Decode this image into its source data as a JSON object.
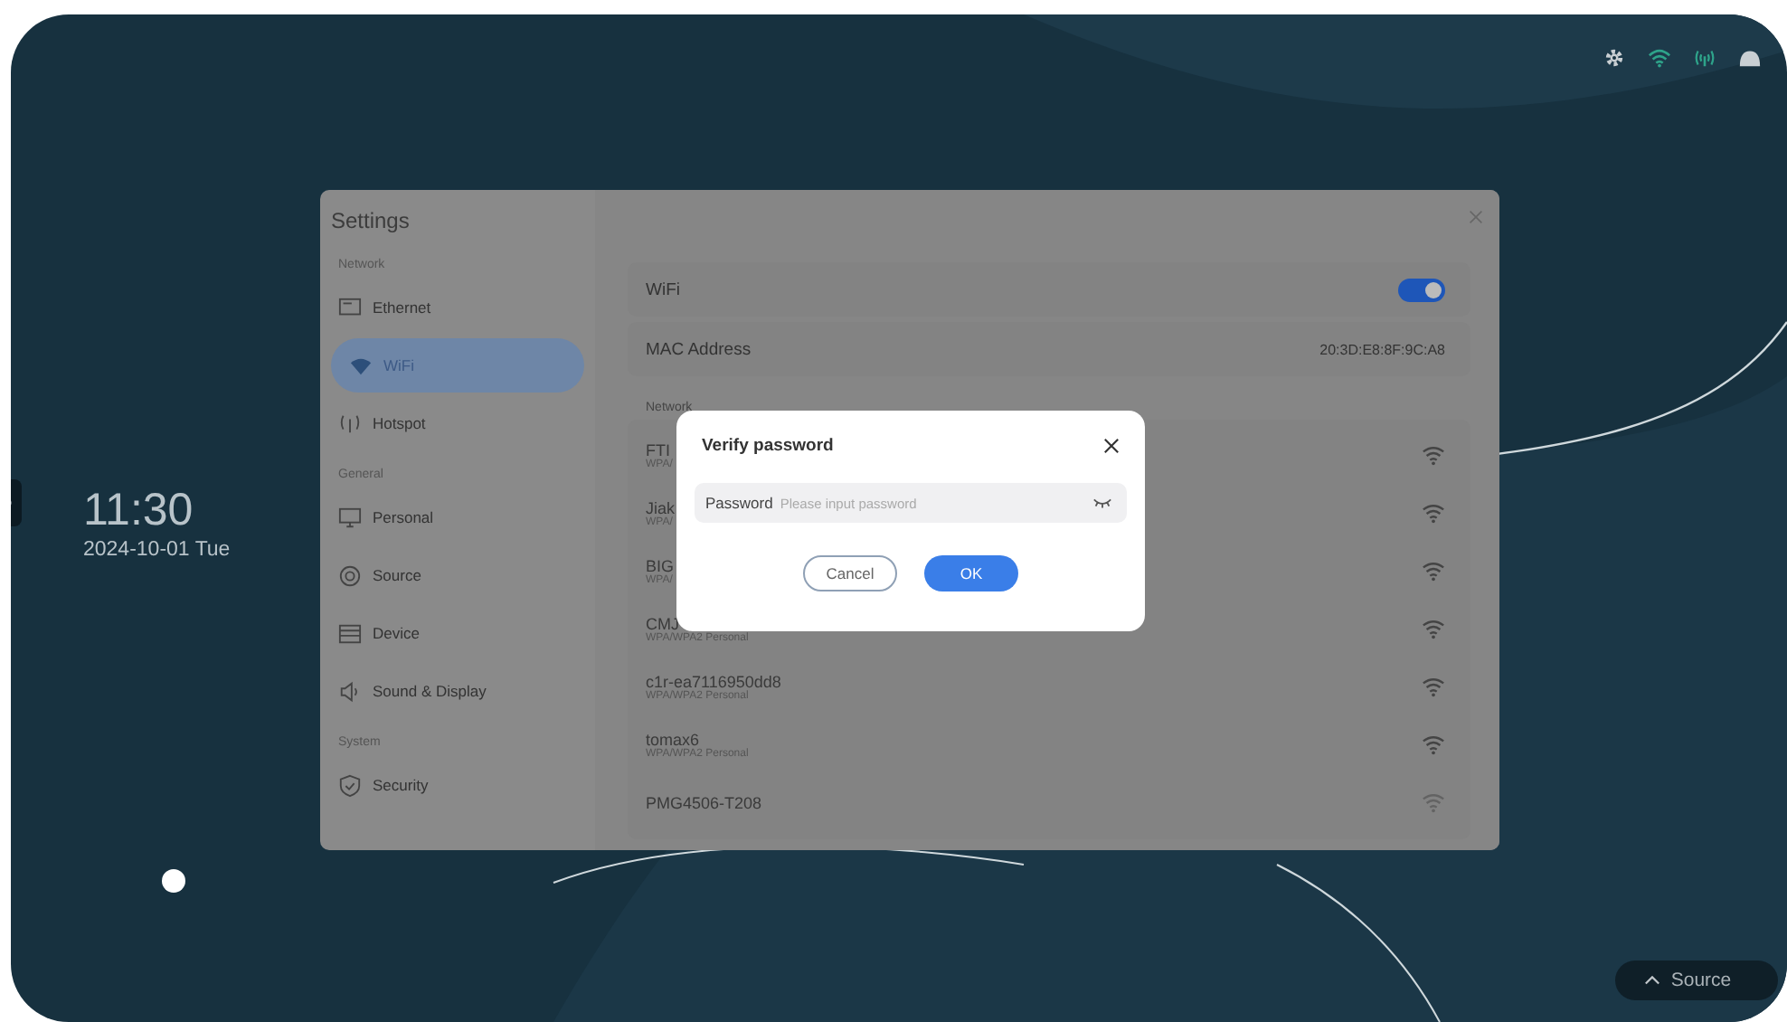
{
  "clock": {
    "time": "11:30",
    "date": "2024-10-01 Tue"
  },
  "settings": {
    "title": "Settings",
    "groups": [
      {
        "header": "Network",
        "items": [
          {
            "label": "Ethernet",
            "selected": false
          },
          {
            "label": "WiFi",
            "selected": true
          },
          {
            "label": "Hotspot",
            "selected": false
          }
        ]
      },
      {
        "header": "General",
        "items": [
          {
            "label": "Personal",
            "selected": false
          },
          {
            "label": "Source",
            "selected": false
          },
          {
            "label": "Device",
            "selected": false
          },
          {
            "label": "Sound & Display",
            "selected": false
          }
        ]
      },
      {
        "header": "System",
        "items": [
          {
            "label": "Security",
            "selected": false
          }
        ]
      }
    ],
    "wifi": {
      "label": "WiFi",
      "on": true
    },
    "mac": {
      "label": "MAC Address",
      "value": "20:3D:E8:8F:9C:A8"
    },
    "network_label": "Network",
    "networks": [
      {
        "name": "FTI",
        "security": "WPA/"
      },
      {
        "name": "Jiak",
        "security": "WPA/"
      },
      {
        "name": "BIG",
        "security": "WPA/"
      },
      {
        "name": "CMJ",
        "security": "WPA/WPA2 Personal"
      },
      {
        "name": "c1r-ea7116950dd8",
        "security": "WPA/WPA2 Personal"
      },
      {
        "name": "tomax6",
        "security": "WPA/WPA2 Personal"
      },
      {
        "name": "PMG4506-T208"
      }
    ]
  },
  "dialog": {
    "title": "Verify password",
    "field_label": "Password",
    "placeholder": "Please input password",
    "buttons": [
      {
        "label": "Cancel",
        "kind": "secondary"
      },
      {
        "label": "OK",
        "kind": "primary"
      }
    ]
  },
  "dock": {
    "label": "Source"
  }
}
